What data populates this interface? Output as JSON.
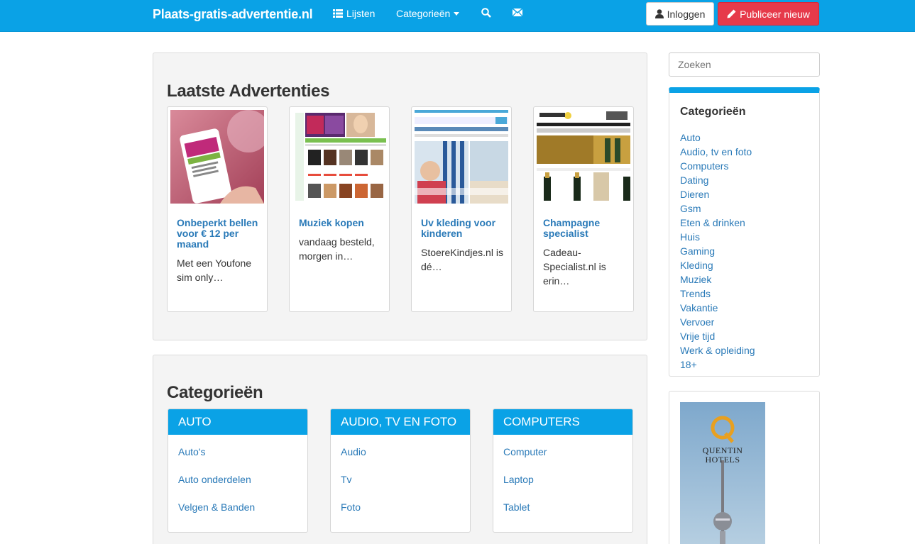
{
  "navbar": {
    "brand": "Plaats-gratis-advertentie.nl",
    "lijsten": "Lijsten",
    "categorieen": "Categorieën",
    "login": "Inloggen",
    "publish": "Publiceer nieuw",
    "bg_color": "#0aa2e6",
    "publish_color": "#e63a4a"
  },
  "latest": {
    "title": "Laatste Advertenties",
    "ads": [
      {
        "title": "Onbeperkt bellen voor € 12 per maand",
        "desc": "Met een Youfone sim only…"
      },
      {
        "title": "Muziek kopen",
        "desc": "vandaag besteld, morgen in…"
      },
      {
        "title": "Uv kleding voor kinderen",
        "desc": "StoereKindjes.nl is dé…"
      },
      {
        "title": "Champagne specialist",
        "desc": "Cadeau-Specialist.nl is erin…"
      }
    ]
  },
  "categories_section": {
    "title": "Categorieën",
    "boxes": [
      {
        "head": "AUTO",
        "items": [
          "Auto's",
          "Auto onderdelen",
          "Velgen & Banden"
        ]
      },
      {
        "head": "AUDIO, TV EN FOTO",
        "items": [
          "Audio",
          "Tv",
          "Foto"
        ]
      },
      {
        "head": "COMPUTERS",
        "items": [
          "Computer",
          "Laptop",
          "Tablet"
        ]
      }
    ]
  },
  "sidebar": {
    "search_placeholder": "Zoeken",
    "categories_title": "Categorieën",
    "categories": [
      "Auto",
      "Audio, tv en foto",
      "Computers",
      "Dating",
      "Dieren",
      "Gsm",
      "Eten & drinken",
      "Huis",
      "Gaming",
      "Kleding",
      "Muziek",
      "Trends",
      "Vakantie",
      "Vervoer",
      "Vrije tijd",
      "Werk & opleiding",
      "18+"
    ],
    "banner": {
      "brand_line1": "QUENTIN",
      "brand_line2": "HOTELS"
    }
  }
}
